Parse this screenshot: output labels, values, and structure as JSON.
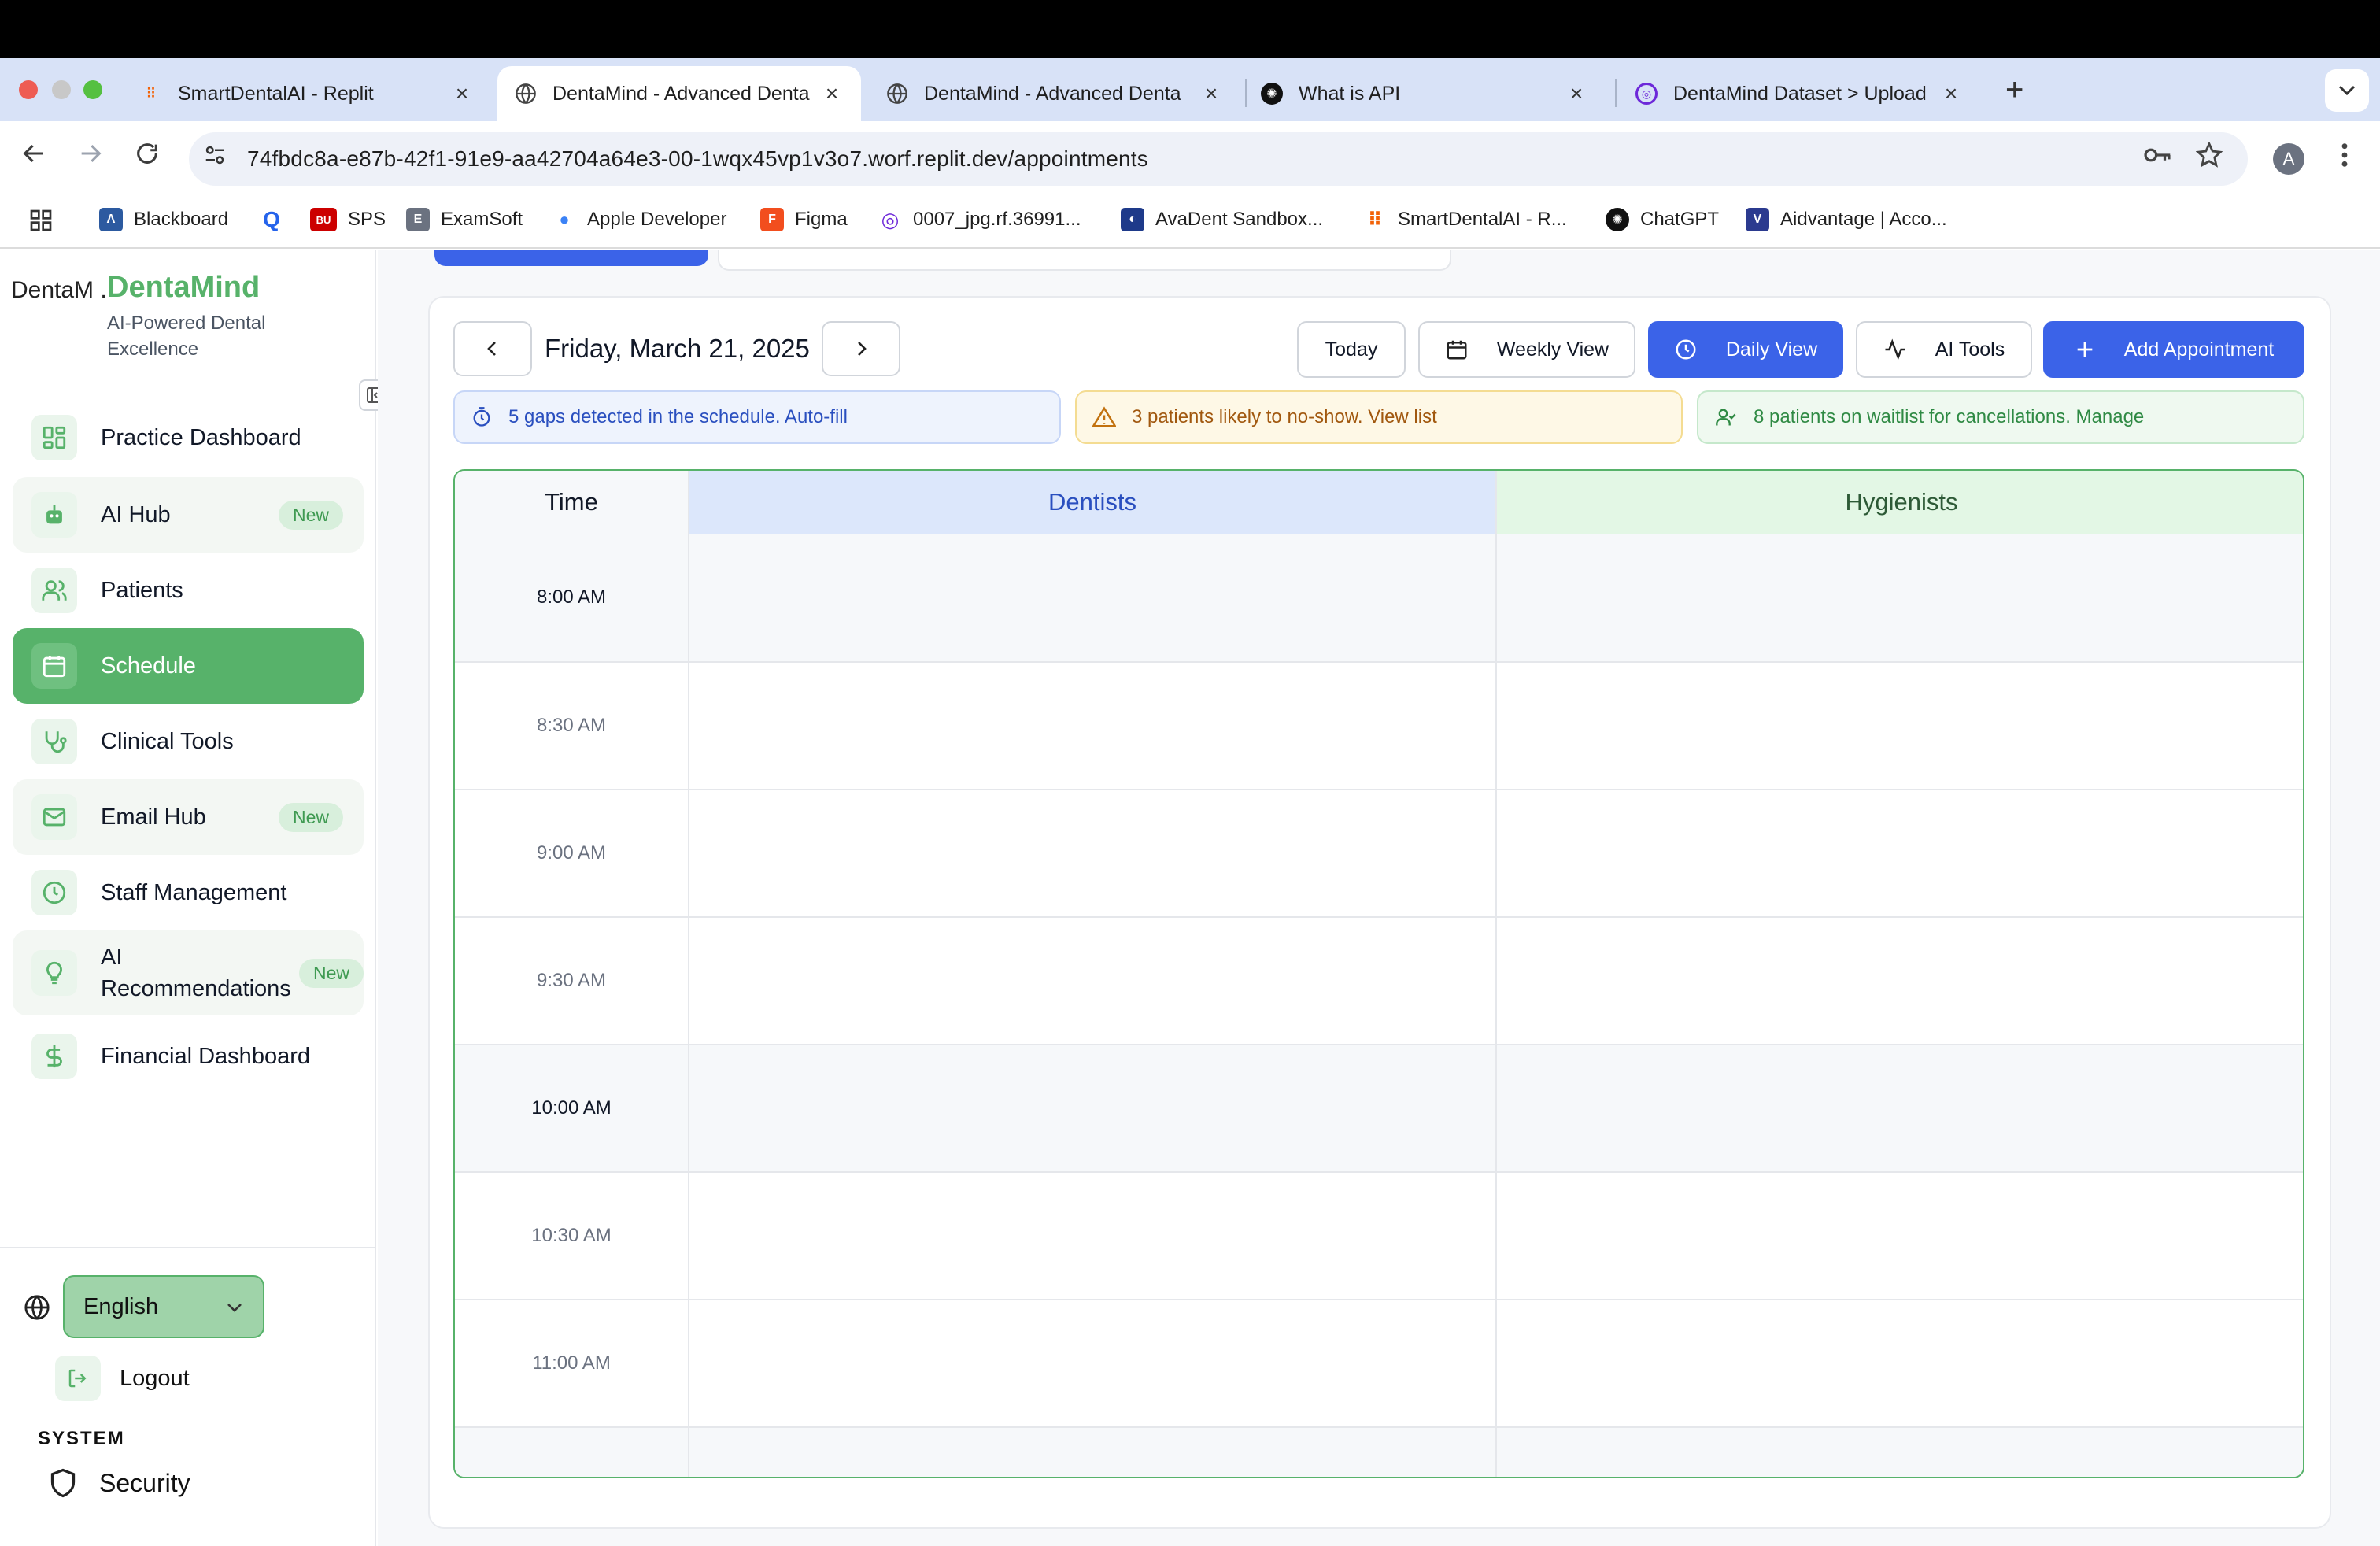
{
  "browser": {
    "tabs": [
      {
        "title": "SmartDentalAI - Replit",
        "icon": "replit-icon",
        "active": false
      },
      {
        "title": "DentaMind - Advanced Denta",
        "icon": "globe-icon",
        "active": true
      },
      {
        "title": "DentaMind - Advanced Denta",
        "icon": "globe-icon",
        "active": false
      },
      {
        "title": "What is API",
        "icon": "openai-icon",
        "active": false
      },
      {
        "title": "DentaMind Dataset > Upload",
        "icon": "roboflow-icon",
        "active": false
      }
    ],
    "close_glyph": "×",
    "new_tab_glyph": "+",
    "url": "74fbdc8a-e87b-42f1-91e9-aa42704a64e3-00-1wqx45vp1v3o7.worf.replit.dev/appointments",
    "profile_initial": "A",
    "bookmarks": [
      {
        "label": "Blackboard",
        "icon": "blackboard-icon",
        "color": "#2c5aa0",
        "glyph": "Λ"
      },
      {
        "label": "",
        "icon": "q-icon",
        "color": "#2563eb",
        "glyph": "Q"
      },
      {
        "label": "SPS",
        "icon": "bu-icon",
        "color": "#cc0000",
        "glyph": "BU"
      },
      {
        "label": "ExamSoft",
        "icon": "examsoft-icon",
        "color": "#6b7280",
        "glyph": "E"
      },
      {
        "label": "Apple Developer",
        "icon": "apple-icon",
        "color": "#3b82f6",
        "glyph": "●"
      },
      {
        "label": "Figma",
        "icon": "figma-icon",
        "color": "#f24e1e",
        "glyph": "F"
      },
      {
        "label": "0007_jpg.rf.36991...",
        "icon": "roboflow-icon",
        "color": "#6d28d9",
        "glyph": "◎"
      },
      {
        "label": "AvaDent Sandbox...",
        "icon": "avadent-icon",
        "color": "#1e3a8a",
        "glyph": "◐"
      },
      {
        "label": "SmartDentalAI - R...",
        "icon": "replit-icon",
        "color": "#f26207",
        "glyph": "⠿"
      },
      {
        "label": "ChatGPT",
        "icon": "openai-icon",
        "color": "#111111",
        "glyph": "✺"
      },
      {
        "label": "Aidvantage | Acco...",
        "icon": "aidvantage-icon",
        "color": "#2b3a8f",
        "glyph": "V"
      }
    ]
  },
  "sidebar": {
    "logo_alt": "DentaM .",
    "brand": "DentaMind",
    "tagline": "AI-Powered Dental Excellence",
    "items": [
      {
        "label": "Practice Dashboard",
        "icon": "dashboard-grid-icon",
        "badge": "",
        "state": "normal"
      },
      {
        "label": "AI Hub",
        "icon": "ai-bot-icon",
        "badge": "New",
        "state": "tinted"
      },
      {
        "label": "Patients",
        "icon": "users-icon",
        "badge": "",
        "state": "normal"
      },
      {
        "label": "Schedule",
        "icon": "calendar-icon",
        "badge": "",
        "state": "active"
      },
      {
        "label": "Clinical Tools",
        "icon": "stethoscope-icon",
        "badge": "",
        "state": "normal"
      },
      {
        "label": "Email Hub",
        "icon": "mail-icon",
        "badge": "New",
        "state": "tinted"
      },
      {
        "label": "Staff Management",
        "icon": "clock-icon",
        "badge": "",
        "state": "normal"
      },
      {
        "label": "AI Recommendations",
        "icon": "lightbulb-icon",
        "badge": "New",
        "state": "tinted"
      },
      {
        "label": "Financial Dashboard",
        "icon": "dollar-icon",
        "badge": "",
        "state": "normal"
      }
    ],
    "language": "English",
    "logout": "Logout",
    "system_label": "SYSTEM",
    "security": "Security"
  },
  "schedule": {
    "date": "Friday, March 21, 2025",
    "today": "Today",
    "weekly_view": "Weekly View",
    "daily_view": "Daily View",
    "ai_tools": "AI Tools",
    "add_appointment": "Add Appointment",
    "alerts": {
      "gaps": "5 gaps detected in the schedule. Auto-fill",
      "no_show": "3 patients likely to no-show. View list",
      "waitlist": "8 patients on waitlist for cancellations. Manage"
    },
    "columns": {
      "time": "Time",
      "dentists": "Dentists",
      "hygienists": "Hygienists"
    },
    "slots": [
      "8:00 AM",
      "8:30 AM",
      "9:00 AM",
      "9:30 AM",
      "10:00 AM",
      "10:30 AM",
      "11:00 AM",
      ""
    ]
  },
  "colors": {
    "brand_green": "#57b26a",
    "primary_blue": "#3b63e8",
    "dentists_header": "#dce7fb",
    "dentists_text": "#2a4fbf",
    "hygienists_header": "#e3f7e5",
    "hygienists_text": "#2d5a36"
  }
}
